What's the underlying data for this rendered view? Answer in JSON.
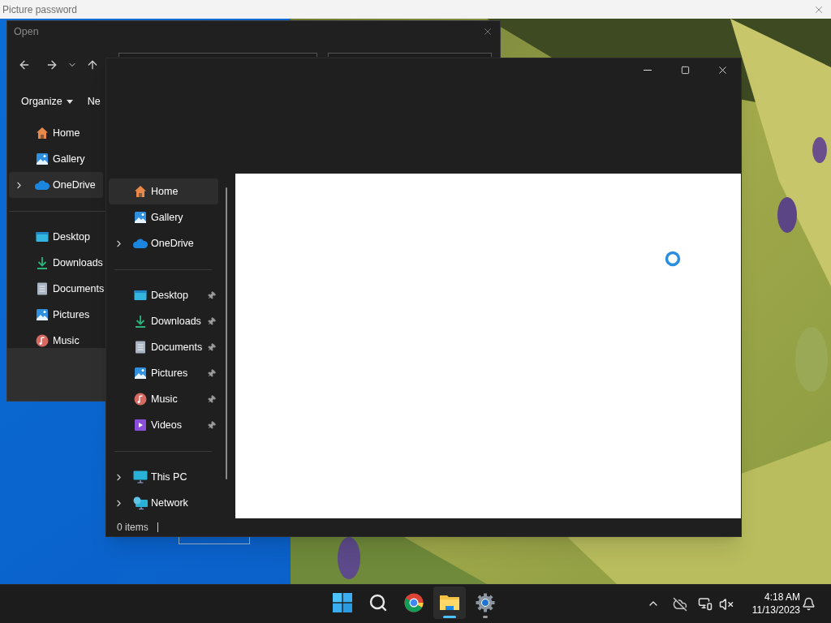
{
  "top_bar": {
    "title": "Picture password"
  },
  "open_dialog": {
    "title": "Open",
    "toolbar": [
      {
        "label": "Organize",
        "kind": "menu"
      },
      {
        "label": "Ne",
        "kind": "button"
      }
    ],
    "sidebar": [
      {
        "kind": "home",
        "label": "Home",
        "selected": false
      },
      {
        "kind": "gallery",
        "label": "Gallery",
        "selected": false
      },
      {
        "kind": "onedrive",
        "label": "OneDrive",
        "selected": true,
        "expanded": false
      },
      {
        "kind": "separator"
      },
      {
        "kind": "desktop",
        "label": "Desktop",
        "selected": false
      },
      {
        "kind": "downloads",
        "label": "Downloads",
        "selected": false
      },
      {
        "kind": "documents",
        "label": "Documents",
        "selected": false
      },
      {
        "kind": "pictures",
        "label": "Pictures",
        "selected": false
      },
      {
        "kind": "music",
        "label": "Music",
        "selected": false
      }
    ]
  },
  "explorer": {
    "sidebar": [
      {
        "kind": "home",
        "label": "Home",
        "selected": true
      },
      {
        "kind": "gallery",
        "label": "Gallery",
        "selected": false
      },
      {
        "kind": "onedrive",
        "label": "OneDrive",
        "selected": false,
        "expanded": false
      },
      {
        "kind": "separator"
      },
      {
        "kind": "desktop",
        "label": "Desktop",
        "selected": false,
        "pinned": true
      },
      {
        "kind": "downloads",
        "label": "Downloads",
        "selected": false,
        "pinned": true
      },
      {
        "kind": "documents",
        "label": "Documents",
        "selected": false,
        "pinned": true
      },
      {
        "kind": "pictures",
        "label": "Pictures",
        "selected": false,
        "pinned": true
      },
      {
        "kind": "music",
        "label": "Music",
        "selected": false,
        "pinned": true
      },
      {
        "kind": "videos",
        "label": "Videos",
        "selected": false,
        "pinned": true
      },
      {
        "kind": "separator"
      },
      {
        "kind": "thispc",
        "label": "This PC",
        "selected": false,
        "expanded": false
      },
      {
        "kind": "network",
        "label": "Network",
        "selected": false,
        "expanded": false
      }
    ],
    "loading": true,
    "status": "0 items"
  },
  "taskbar": {
    "apps": [
      {
        "kind": "start",
        "active": false,
        "running": false
      },
      {
        "kind": "search",
        "active": false,
        "running": false
      },
      {
        "kind": "browser",
        "active": false,
        "running": false
      },
      {
        "kind": "files",
        "active": true,
        "running": true
      },
      {
        "kind": "settings",
        "active": false,
        "running": true
      }
    ],
    "time": "4:18 AM",
    "date": "11/13/2023"
  }
}
